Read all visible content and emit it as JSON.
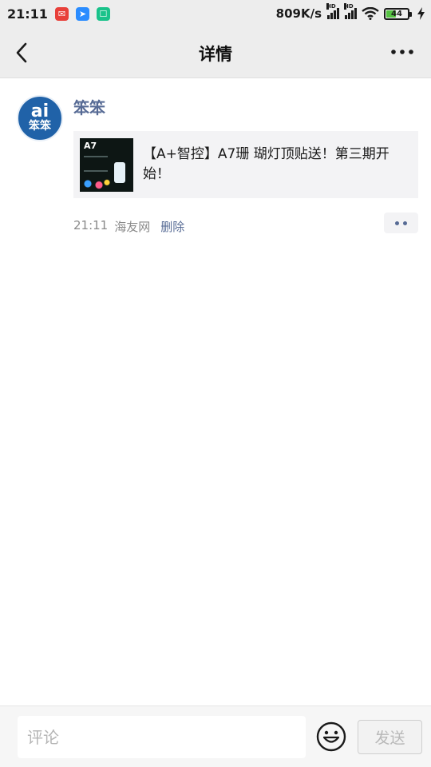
{
  "status_bar": {
    "time": "21:11",
    "network_speed": "809K/s",
    "signal_label": "HD",
    "battery_level": "44",
    "app_icons": [
      "weibo-notification-icon",
      "tool-notification-icon",
      "message-notification-icon"
    ]
  },
  "nav": {
    "title": "详情"
  },
  "post": {
    "author": "笨笨",
    "avatar_text_top": "ai",
    "avatar_text_bottom": "笨笨",
    "share_thumb_label": "A7",
    "share_title": "【A+智控】A7珊 瑚灯顶贴送！第三期开始！",
    "time": "21:11",
    "source": "海友网",
    "delete_label": "删除"
  },
  "comment_bar": {
    "placeholder": "评论",
    "value": "",
    "send_label": "发送"
  },
  "colors": {
    "accent_link": "#576b95",
    "bar_background": "#ededed",
    "card_background": "#f3f3f5"
  }
}
